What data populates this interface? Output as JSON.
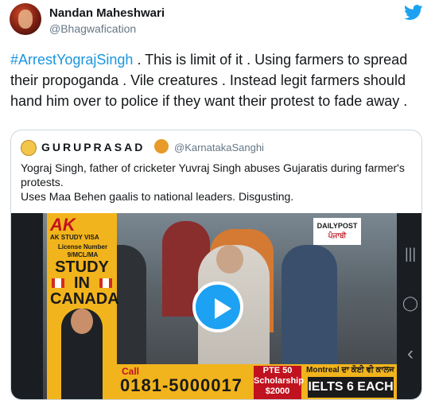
{
  "tweet": {
    "author_name": "Nandan Maheshwari",
    "author_handle": "@Bhagwafication",
    "hashtag": "#ArrestYograjSingh",
    "body": " . This is limit of it . Using farmers to spread their propoganda . Vile creatures . Instead legit farmers should hand him over to police if they  want their protest to fade away ."
  },
  "quoted": {
    "author_name": "GURUPRASAD",
    "author_handle": "@KarnatakaSanghi",
    "lines": [
      "Yograj Singh, father of cricketer Yuvraj Singh abuses Gujaratis during farmer's protests.",
      "Uses Maa Behen gaalis to national leaders. Disgusting."
    ],
    "video": {
      "ad": {
        "logo": "AK",
        "sub": "AK STUDY VISA",
        "license_lines": [
          "License Number",
          "9/MCL/MA"
        ],
        "headline_lines": [
          "STUDY",
          "IN",
          "CANADA"
        ]
      },
      "ticker": {
        "call": "Call",
        "phone": "0181-5000017",
        "pte_lines": [
          "PTE 50",
          "Scholarship",
          "$2000"
        ],
        "montreal": "Montreal ਦਾ ਕੋਈ ਵੀ ਕਾਲਜ",
        "ielts": "IELTS 6 EACH"
      },
      "watermark_lines": [
        "DAILYPOST",
        "ਪੰਜਾਬੀ"
      ]
    }
  },
  "icons": {
    "brand": "twitter-bird-icon",
    "play": "play-icon",
    "nav": [
      "recent-apps-icon",
      "home-icon",
      "back-icon"
    ]
  },
  "colors": {
    "twitter_blue": "#1da1f2",
    "hashtag": "#1b95e0",
    "text": "#14171a",
    "secondary_text": "#657786",
    "border": "#ccd6dd"
  },
  "nav_glyphs": [
    "|||",
    "◯",
    "‹"
  ]
}
